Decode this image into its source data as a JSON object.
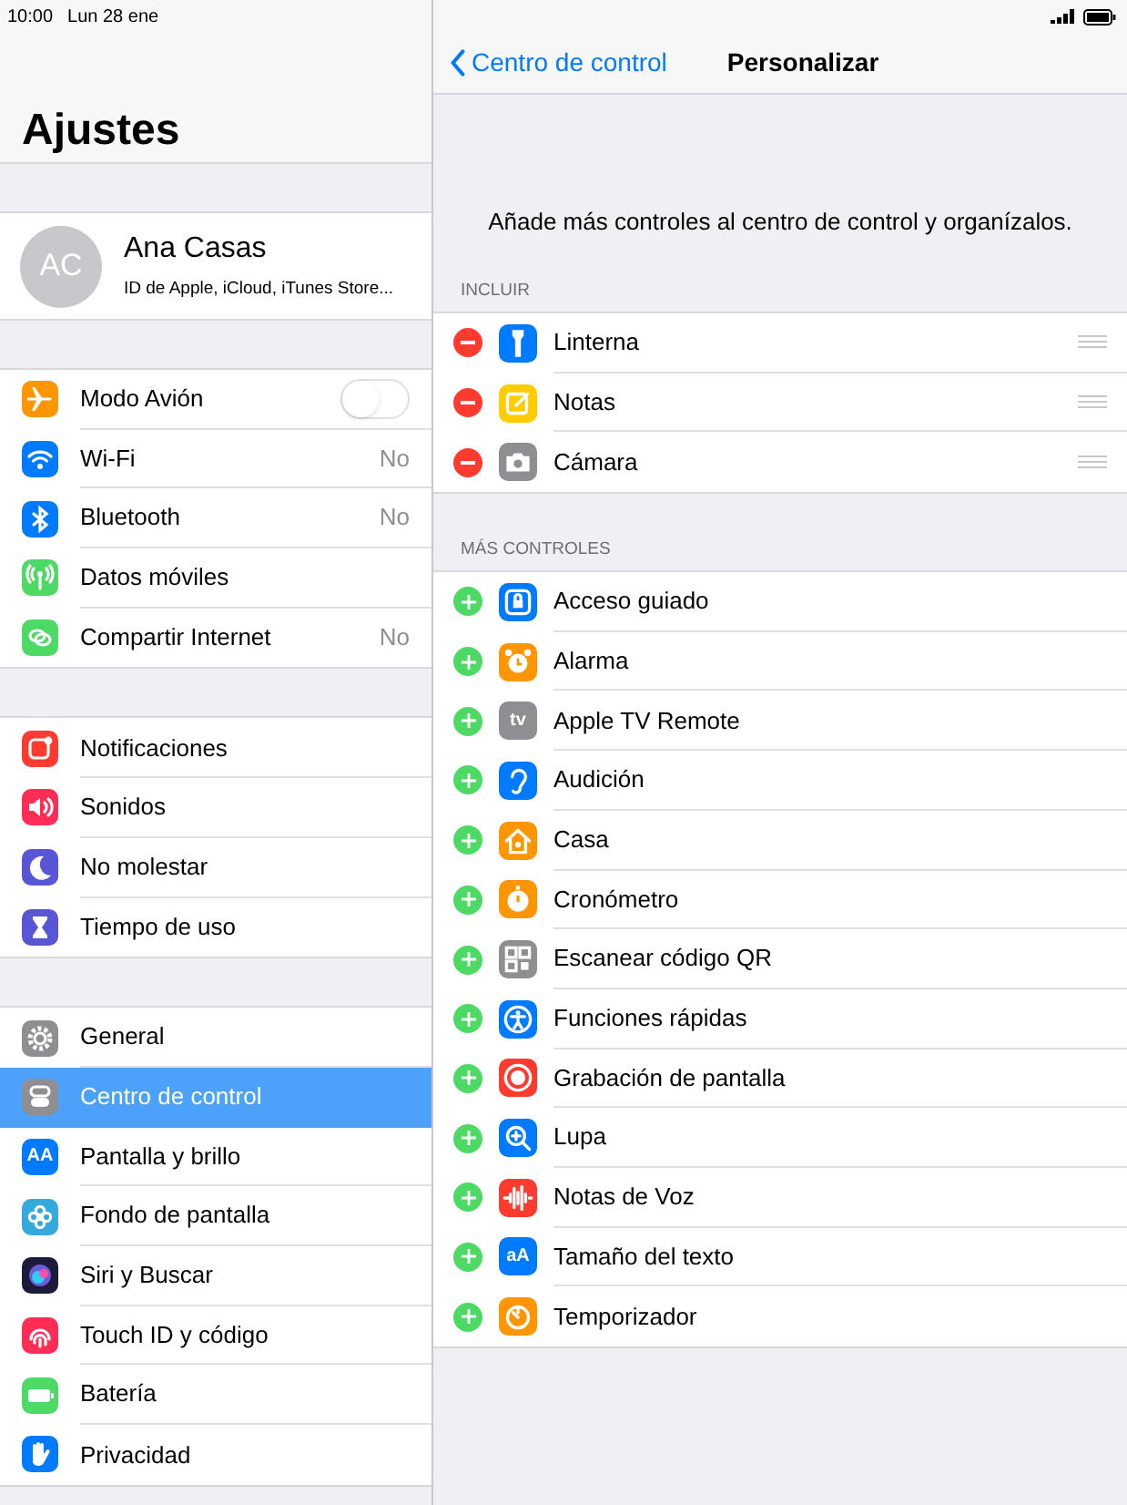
{
  "status_bar": {
    "time": "10:00",
    "date": "Lun 28 ene"
  },
  "sidebar": {
    "title": "Ajustes",
    "profile": {
      "initials": "AC",
      "name": "Ana Casas",
      "subtitle": "ID de Apple, iCloud, iTunes Store..."
    },
    "groups": [
      [
        {
          "label": "Modo Avión",
          "kind": "toggle",
          "on": false,
          "color": "#ff9500",
          "selected": false
        },
        {
          "label": "Wi-Fi",
          "kind": "value",
          "value": "No",
          "color": "#007aff",
          "selected": false
        },
        {
          "label": "Bluetooth",
          "kind": "value",
          "value": "No",
          "color": "#007aff",
          "selected": false
        },
        {
          "label": "Datos móviles",
          "kind": "plain",
          "color": "#4cd964",
          "selected": false
        },
        {
          "label": "Compartir Internet",
          "kind": "value",
          "value": "No",
          "color": "#4cd964",
          "selected": false
        }
      ],
      [
        {
          "label": "Notificaciones",
          "kind": "plain",
          "color": "#ff3b30",
          "selected": false
        },
        {
          "label": "Sonidos",
          "kind": "plain",
          "color": "#ff2d55",
          "selected": false
        },
        {
          "label": "No molestar",
          "kind": "plain",
          "color": "#5856d6",
          "selected": false
        },
        {
          "label": "Tiempo de uso",
          "kind": "plain",
          "color": "#5856d6",
          "selected": false
        }
      ],
      [
        {
          "label": "General",
          "kind": "plain",
          "color": "#8e8e93",
          "selected": false
        },
        {
          "label": "Centro de control",
          "kind": "plain",
          "color": "#8e8e93",
          "selected": true
        },
        {
          "label": "Pantalla y brillo",
          "kind": "plain",
          "color": "#007aff",
          "icon_text": "AA",
          "selected": false
        },
        {
          "label": "Fondo de pantalla",
          "kind": "plain",
          "color": "#34aadc",
          "selected": false
        },
        {
          "label": "Siri y Buscar",
          "kind": "plain",
          "color": "#1c1c3a",
          "selected": false
        },
        {
          "label": "Touch ID y código",
          "kind": "plain",
          "color": "#ff2d55",
          "selected": false
        },
        {
          "label": "Batería",
          "kind": "plain",
          "color": "#4cd964",
          "selected": false
        },
        {
          "label": "Privacidad",
          "kind": "plain",
          "color": "#007aff",
          "selected": false
        }
      ]
    ]
  },
  "detail": {
    "back": "Centro de control",
    "title": "Personalizar",
    "description": "Añade más controles al centro de control y organízalos.",
    "sections": [
      {
        "header": "INCLUIR",
        "kind": "included",
        "items": [
          {
            "label": "Linterna",
            "color": "#007aff"
          },
          {
            "label": "Notas",
            "color": "#ffcc00"
          },
          {
            "label": "Cámara",
            "color": "#8e8e93"
          }
        ]
      },
      {
        "header": "MÁS CONTROLES",
        "kind": "available",
        "items": [
          {
            "label": "Acceso guiado",
            "color": "#007aff"
          },
          {
            "label": "Alarma",
            "color": "#ff9500"
          },
          {
            "label": "Apple TV Remote",
            "color": "#8e8e93",
            "icon_text": "tv"
          },
          {
            "label": "Audición",
            "color": "#007aff"
          },
          {
            "label": "Casa",
            "color": "#ff9500"
          },
          {
            "label": "Cronómetro",
            "color": "#ff9500"
          },
          {
            "label": "Escanear código QR",
            "color": "#8e8e93"
          },
          {
            "label": "Funciones rápidas",
            "color": "#007aff"
          },
          {
            "label": "Grabación de pantalla",
            "color": "#ff3b30"
          },
          {
            "label": "Lupa",
            "color": "#007aff"
          },
          {
            "label": "Notas de Voz",
            "color": "#ff3b30"
          },
          {
            "label": "Tamaño del texto",
            "color": "#007aff",
            "icon_text": "aA"
          },
          {
            "label": "Temporizador",
            "color": "#ff9500"
          }
        ]
      }
    ]
  }
}
